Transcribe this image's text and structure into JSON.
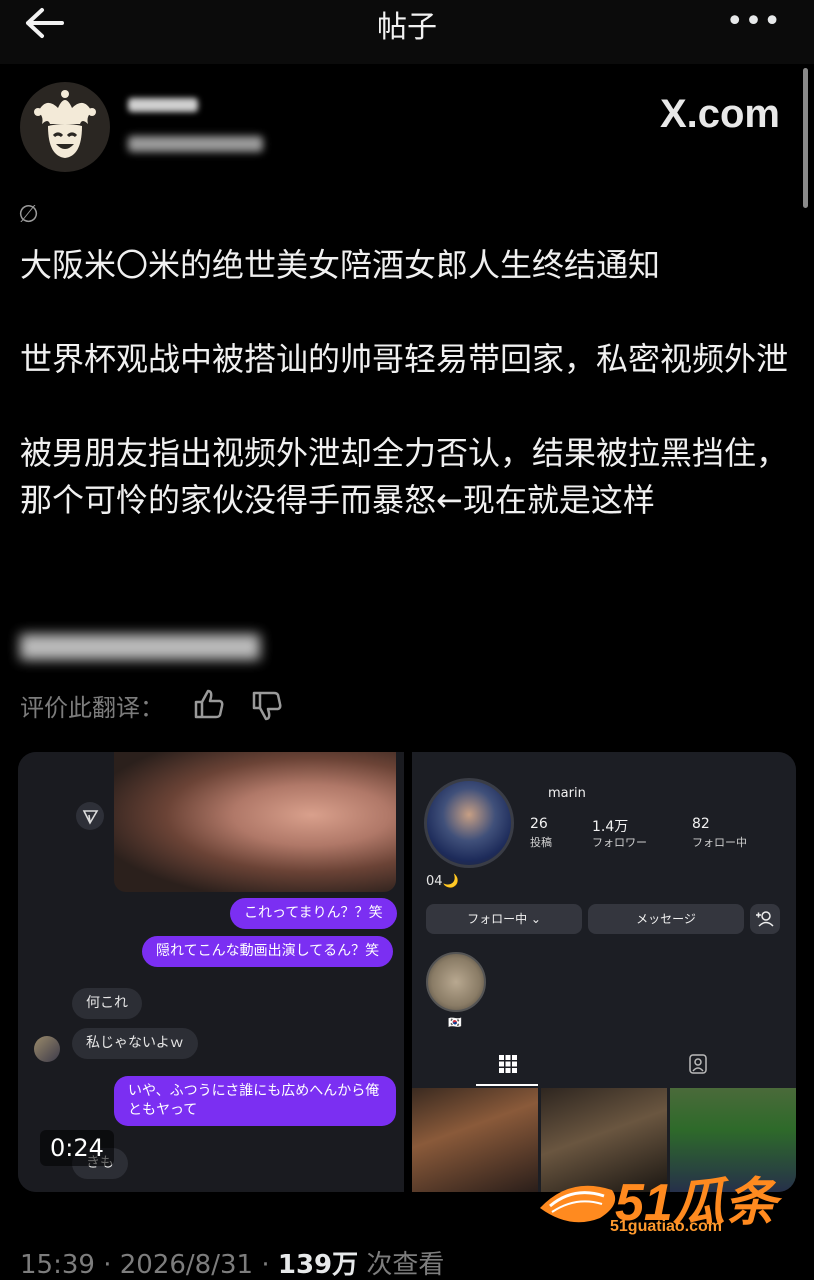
{
  "header": {
    "title": "帖子",
    "more_label": "•••"
  },
  "author": {
    "source_badge": "X.com"
  },
  "post": {
    "text": "大阪米〇米的绝世美女陪酒女郎人生终结通知\n\n世界杯观战中被搭讪的帅哥轻易带回家，私密视频外泄\n\n被男朋友指出视频外泄却全力否认，结果被拉黑挡住，那个可怜的家伙没得手而暴怒←现在就是这样",
    "translate_icon": "∅",
    "rate_translation_label": "评价此翻译："
  },
  "media": {
    "chat": {
      "messages": [
        {
          "side": "me",
          "text": "これってまりん？？笑"
        },
        {
          "side": "me",
          "text": "隠れてこんな動画出演してるん？笑"
        },
        {
          "side": "them",
          "text": "何これ"
        },
        {
          "side": "them",
          "text": "私じゃないよｗ"
        },
        {
          "side": "me",
          "text": "いや、ふつうにさ誰にも広めへんから俺ともヤって"
        },
        {
          "side": "them",
          "text": "きも"
        }
      ],
      "duration": "0:24"
    },
    "profile": {
      "username": "marin",
      "stats": [
        {
          "value": "26",
          "label": "投稿"
        },
        {
          "value": "1.4万",
          "label": "フォロワー"
        },
        {
          "value": "82",
          "label": "フォロー中"
        }
      ],
      "bio": "04🌙",
      "follow_button": "フォロー中 ⌄",
      "message_button": "メッセージ",
      "highlight_label": "🇰🇷"
    }
  },
  "watermark": {
    "brand": "51瓜条",
    "url": "51guatiao.com"
  },
  "meta": {
    "time": "15:39",
    "date": "2026/8/31",
    "views": "139万",
    "views_label": "次查看",
    "separator": " · "
  },
  "colors": {
    "background": "#000000",
    "purple_bubble": "#7b2ff2",
    "watermark_orange": "#ff8a1f"
  }
}
